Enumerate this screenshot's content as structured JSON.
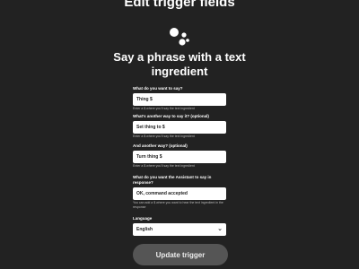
{
  "header": {
    "title": "Edit trigger fields"
  },
  "trigger": {
    "title": "Say a phrase with a text ingredient"
  },
  "fields": [
    {
      "label": "What do you want to say?",
      "value": "Thing $",
      "helper": "Enter a $ where you'll say the text ingredient"
    },
    {
      "label": "What's another way to say it? (optional)",
      "value": "Set thing to $",
      "helper": "Enter a $ where you'll say the text ingredient"
    },
    {
      "label": "And another way? (optional)",
      "value": "Turn thing $",
      "helper": "Enter a $ where you'll say the text ingredient"
    },
    {
      "label": "What do you want the Assistant to say in response?",
      "value": "OK, command accepted",
      "helper": "You can add a $ where you want to hear the text ingredient in the response"
    }
  ],
  "language": {
    "label": "Language",
    "selected": "English"
  },
  "actions": {
    "update_label": "Update trigger"
  },
  "colors": {
    "background": "#222222",
    "button": "#555555"
  }
}
